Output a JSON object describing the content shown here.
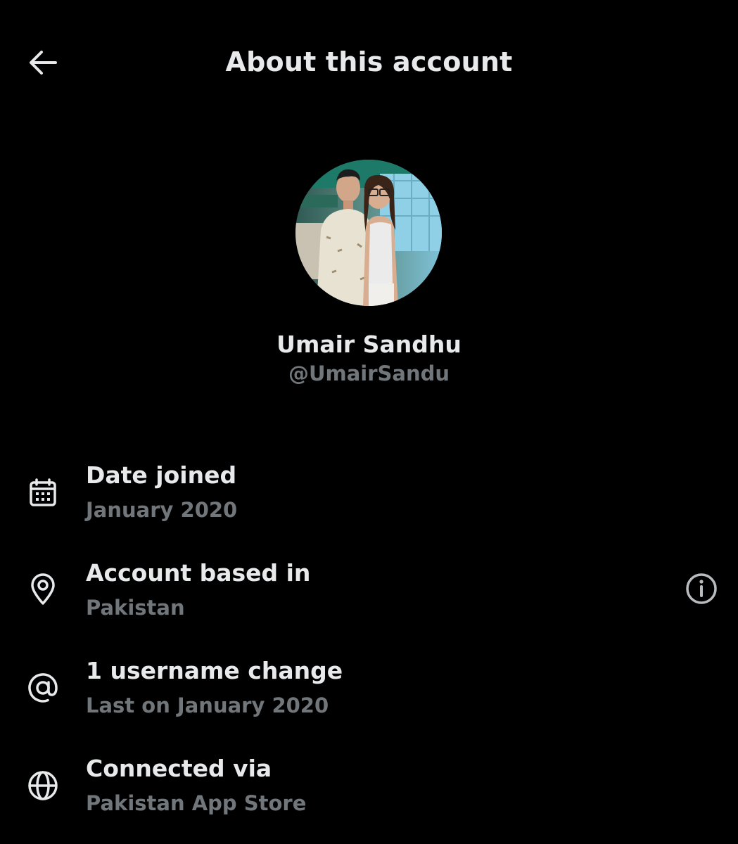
{
  "header": {
    "title": "About this account",
    "back_icon": "arrow-left-icon"
  },
  "profile": {
    "display_name": "Umair Sandhu",
    "handle": "@UmairSandu",
    "avatar": "profile-photo"
  },
  "info": {
    "date_joined": {
      "icon": "calendar-icon",
      "title": "Date joined",
      "value": "January 2020"
    },
    "account_based_in": {
      "icon": "location-pin-icon",
      "title": "Account based in",
      "value": "Pakistan",
      "info_icon": "info-circle-icon"
    },
    "username_change": {
      "icon": "at-sign-icon",
      "title": "1 username change",
      "value": "Last on January 2020"
    },
    "connected_via": {
      "icon": "globe-icon",
      "title": "Connected via",
      "value": "Pakistan App Store"
    }
  },
  "colors": {
    "background": "#000000",
    "primary_text": "#e7e9ea",
    "secondary_text": "#71767b"
  }
}
